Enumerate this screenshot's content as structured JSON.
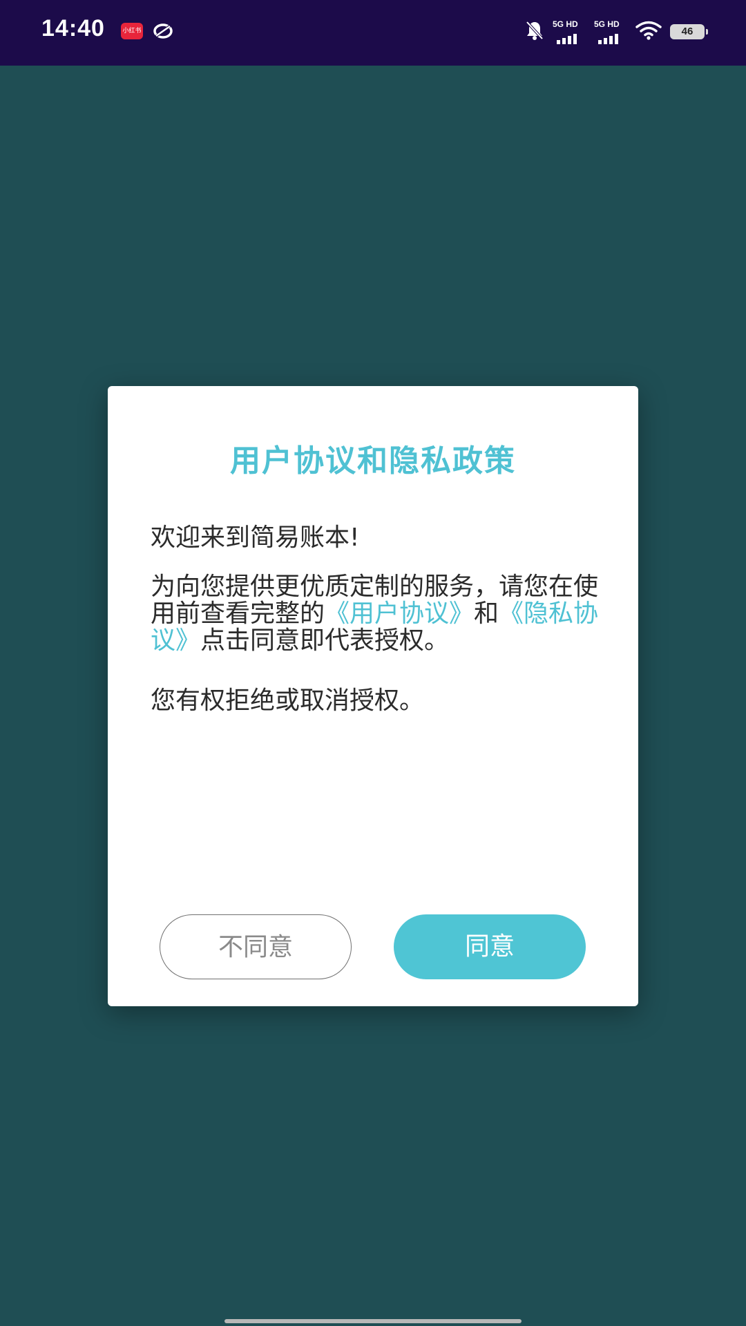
{
  "status_bar": {
    "time": "14:40",
    "notification_icons": [
      "xiaohongshu-icon",
      "ring-icon"
    ],
    "signal_1_label": "5G HD",
    "signal_2_label": "5G HD",
    "battery_level": "46"
  },
  "dialog": {
    "title": "用户协议和隐私政策",
    "welcome": "欢迎来到简易账本!",
    "body_part1": "为向您提供更优质定制的服务，请您在使用前查看完整的",
    "user_agreement_link": "《用户协议》",
    "body_part2": "和",
    "privacy_link": "《隐私协议》",
    "body_part3": "点击同意即代表授权。",
    "rights_text": "您有权拒绝或取消授权。",
    "disagree_label": "不同意",
    "agree_label": "同意"
  },
  "colors": {
    "background": "#1f4e54",
    "status_bar": "#1c0b4a",
    "accent": "#4fc1d3",
    "agree_button": "#4fc5d4"
  }
}
